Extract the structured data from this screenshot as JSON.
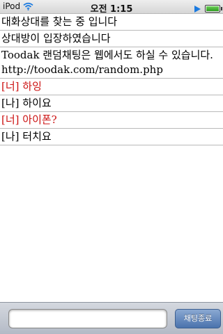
{
  "status_bar": {
    "carrier": "iPod",
    "time": "오전 1:15",
    "battery_level": 1.0,
    "icons": [
      "wifi-icon",
      "play-icon",
      "battery-icon"
    ],
    "colors": {
      "accent": "#1a7ae0"
    }
  },
  "chat": {
    "lines": [
      {
        "type": "system",
        "text": "대화상대를 찾는 중 입니다"
      },
      {
        "type": "system",
        "text": "상대방이 입장하였습니다"
      },
      {
        "type": "system",
        "text": "Toodak 랜덤채팅은 웹에서도 하실 수 있습니다. http://toodak.com/random.php"
      },
      {
        "type": "partner",
        "text": "[너] 하잉"
      },
      {
        "type": "me",
        "text": "[나] 하이요"
      },
      {
        "type": "partner",
        "text": "[너] 아이폰?"
      },
      {
        "type": "me",
        "text": "[나] 터치요"
      }
    ],
    "colors": {
      "partner": "#cc1111",
      "me": "#000000"
    }
  },
  "input_bar": {
    "message_value": "",
    "message_placeholder": "",
    "end_button_label": "채팅종료"
  }
}
